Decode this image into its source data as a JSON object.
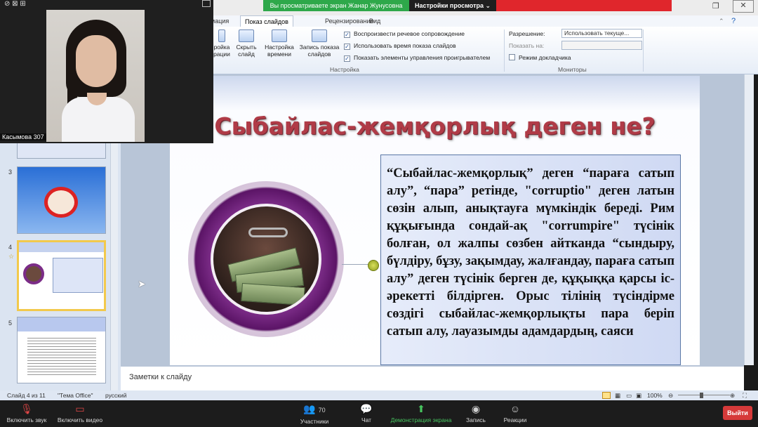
{
  "zoom": {
    "share_banner": "Вы просматриваете экран Жанар Жунусовна",
    "view_options": "Настройки просмотра",
    "participant_name": "Касымова 307",
    "participants_count": "70",
    "bottom": {
      "mute": "Включить звук",
      "video": "Включить видео",
      "participants": "Участники",
      "chat": "Чат",
      "share": "Демонстрация экрана",
      "record": "Запись",
      "reactions": "Реакции",
      "leave": "Выйти"
    }
  },
  "ribbon": {
    "tabs": [
      "мация",
      "Показ слайдов",
      "Рецензирование",
      "Вид"
    ],
    "buttons": {
      "b1": "ройка\nрации",
      "hide": "Скрыть\nслайд",
      "rehearse": "Настройка\nвремени",
      "record": "Запись показа\nслайдов"
    },
    "checks": [
      "Воспроизвести речевое сопровождение",
      "Использовать время показа слайдов",
      "Показать элементы управления проигрывателем"
    ],
    "group_setup": "Настройка",
    "monitors": {
      "resolution_label": "Разрешение:",
      "resolution_value": "Использовать текуще...",
      "show_on_label": "Показать на:",
      "presenter_view": "Режим докладчика",
      "group_label": "Мониторы"
    }
  },
  "slides": {
    "numbers": [
      "3",
      "4",
      "5"
    ]
  },
  "slide": {
    "title": "Сыбайлас-жемқорлық деген не?",
    "body": "“Сыбайлас-жемқорлық” деген “параға сатып алу”, “пара” ретінде, \"corruptio\" деген латын сөзін алып, анықтауға мүмкіндік береді. Рим құқығында сондай-ақ \"corrumpire\" түсінік болған, ол жалпы сөзбен айтканда “сындыру, бүлдіру, бұзу, зақымдау, жалғандау, параға сатып алу” деген түсінік берген де, құқыққа қарсы іс-әрекетті білдірген. Орыс тілінің түсіндірме сөздігі сыбайлас-жемқорлықты пара беріп сатып алу, лауазымды адамдардың, саяси"
  },
  "notes_placeholder": "Заметки к слайду",
  "status": {
    "slide_of": "Слайд 4 из 11",
    "theme": "\"Тема Office\"",
    "language": "русский",
    "zoom": "100%"
  }
}
